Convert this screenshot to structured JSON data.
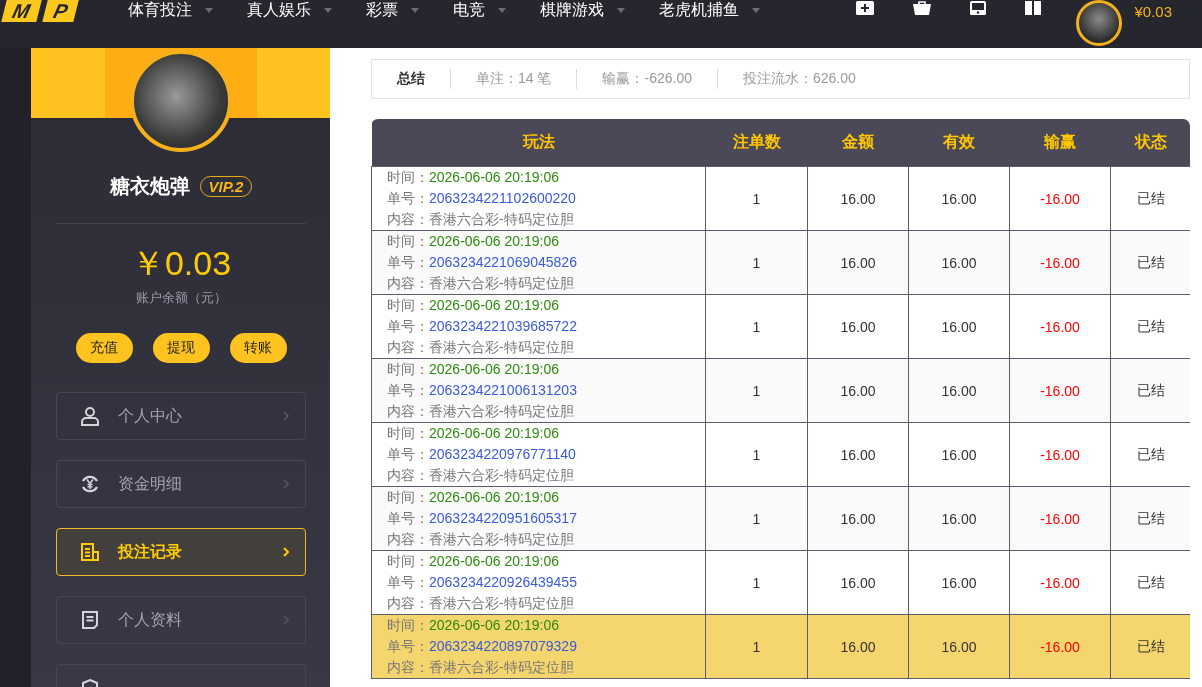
{
  "nav": {
    "logo": [
      "M",
      "P"
    ],
    "items": [
      "体育投注",
      "真人娱乐",
      "彩票",
      "电竞",
      "棋牌游戏",
      "老虎机捕鱼"
    ],
    "balance": "¥0.03"
  },
  "profile": {
    "name": "糖衣炮弹",
    "vip": "VIP.2",
    "balance": "￥0.03",
    "balance_label": "账户余额（元）",
    "actions": [
      "充值",
      "提现",
      "转账"
    ]
  },
  "menu": [
    {
      "label": "个人中心",
      "selected": false
    },
    {
      "label": "资金明细",
      "selected": false
    },
    {
      "label": "投注记录",
      "selected": true
    },
    {
      "label": "个人资料",
      "selected": false
    },
    {
      "selected": false
    }
  ],
  "summary": {
    "title": "总结",
    "items": [
      "单注：14 笔",
      "输赢：-626.00",
      "投注流水：626.00"
    ]
  },
  "table": {
    "columns": [
      "玩法",
      "注单数",
      "金额",
      "有效",
      "输赢",
      "状态"
    ],
    "rows": [
      {
        "time_label": "时间：",
        "time": "2026-06-06 20:19:06",
        "order_label": "单号：",
        "order": "2063234221102600220",
        "content": "内容：香港六合彩-特码定位胆",
        "count": "1",
        "amount": "16.00",
        "valid": "16.00",
        "win": "-16.00",
        "status": "已结",
        "highlighted": false
      },
      {
        "time_label": "时间：",
        "time": "2026-06-06 20:19:06",
        "order_label": "单号：",
        "order": "2063234221069045826",
        "content": "内容：香港六合彩-特码定位胆",
        "count": "1",
        "amount": "16.00",
        "valid": "16.00",
        "win": "-16.00",
        "status": "已结",
        "highlighted": false
      },
      {
        "time_label": "时间：",
        "time": "2026-06-06 20:19:06",
        "order_label": "单号：",
        "order": "2063234221039685722",
        "content": "内容：香港六合彩-特码定位胆",
        "count": "1",
        "amount": "16.00",
        "valid": "16.00",
        "win": "-16.00",
        "status": "已结",
        "highlighted": false
      },
      {
        "time_label": "时间：",
        "time": "2026-06-06 20:19:06",
        "order_label": "单号：",
        "order": "2063234221006131203",
        "content": "内容：香港六合彩-特码定位胆",
        "count": "1",
        "amount": "16.00",
        "valid": "16.00",
        "win": "-16.00",
        "status": "已结",
        "highlighted": false
      },
      {
        "time_label": "时间：",
        "time": "2026-06-06 20:19:06",
        "order_label": "单号：",
        "order": "2063234220976771140",
        "content": "内容：香港六合彩-特码定位胆",
        "count": "1",
        "amount": "16.00",
        "valid": "16.00",
        "win": "-16.00",
        "status": "已结",
        "highlighted": false
      },
      {
        "time_label": "时间：",
        "time": "2026-06-06 20:19:06",
        "order_label": "单号：",
        "order": "2063234220951605317",
        "content": "内容：香港六合彩-特码定位胆",
        "count": "1",
        "amount": "16.00",
        "valid": "16.00",
        "win": "-16.00",
        "status": "已结",
        "highlighted": false
      },
      {
        "time_label": "时间：",
        "time": "2026-06-06 20:19:06",
        "order_label": "单号：",
        "order": "2063234220926439455",
        "content": "内容：香港六合彩-特码定位胆",
        "count": "1",
        "amount": "16.00",
        "valid": "16.00",
        "win": "-16.00",
        "status": "已结",
        "highlighted": false
      },
      {
        "time_label": "时间：",
        "time": "2026-06-06 20:19:06",
        "order_label": "单号：",
        "order": "2063234220897079329",
        "content": "内容：香港六合彩-特码定位胆",
        "count": "1",
        "amount": "16.00",
        "valid": "16.00",
        "win": "-16.00",
        "status": "已结",
        "highlighted": true
      }
    ]
  }
}
